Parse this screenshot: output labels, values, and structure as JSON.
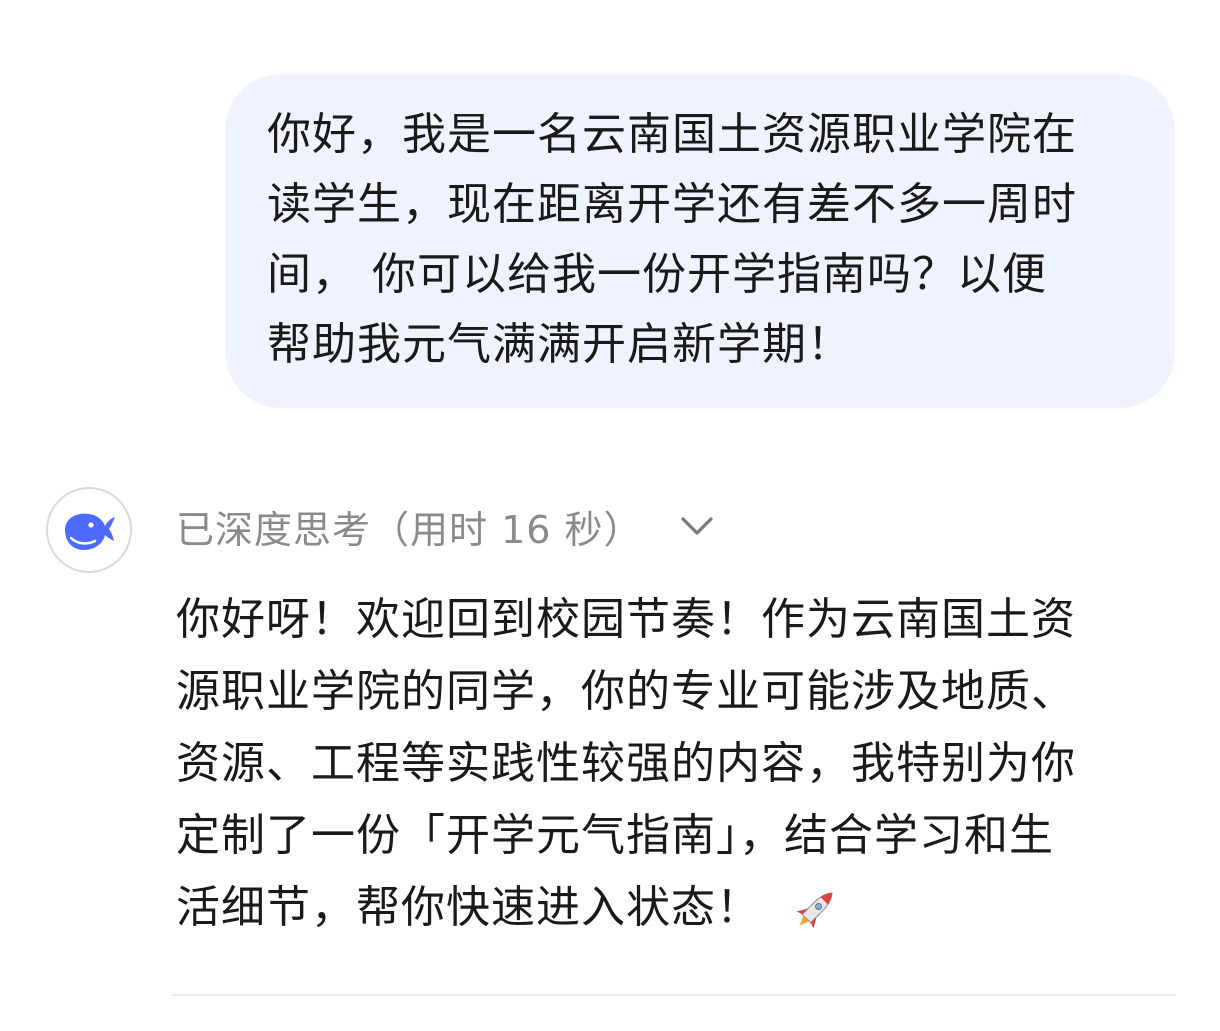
{
  "user_message": {
    "lines": [
      "你好，我是一名云南国土资源职业学院在",
      "读学生，现在距离开学还有差不多一周时",
      "间， 你可以给我一份开学指南吗？以便",
      "帮助我元气满满开启新学期！"
    ]
  },
  "assistant": {
    "avatar_icon": "deepseek-whale-logo",
    "avatar_color": "#4d6bfe",
    "thinking_label": "已深度思考（用时 16 秒）",
    "thinking_toggle_icon": "chevron-down-icon",
    "reply_lines": [
      "你好呀！欢迎回到校园节奏！作为云南国土资",
      "源职业学院的同学，你的专业可能涉及地质、",
      "资源、工程等实践性较强的内容，我特别为你",
      "定制了一份「开学元气指南」，结合学习和生",
      "活细节，帮你快速进入状态！"
    ],
    "reply_emoji_icon": "rocket-icon"
  },
  "colors": {
    "user_bubble_bg": "#eef3fd",
    "muted_text": "#8a8a8a",
    "body_text": "#1a1a1a",
    "divider": "#e9e9e9"
  }
}
